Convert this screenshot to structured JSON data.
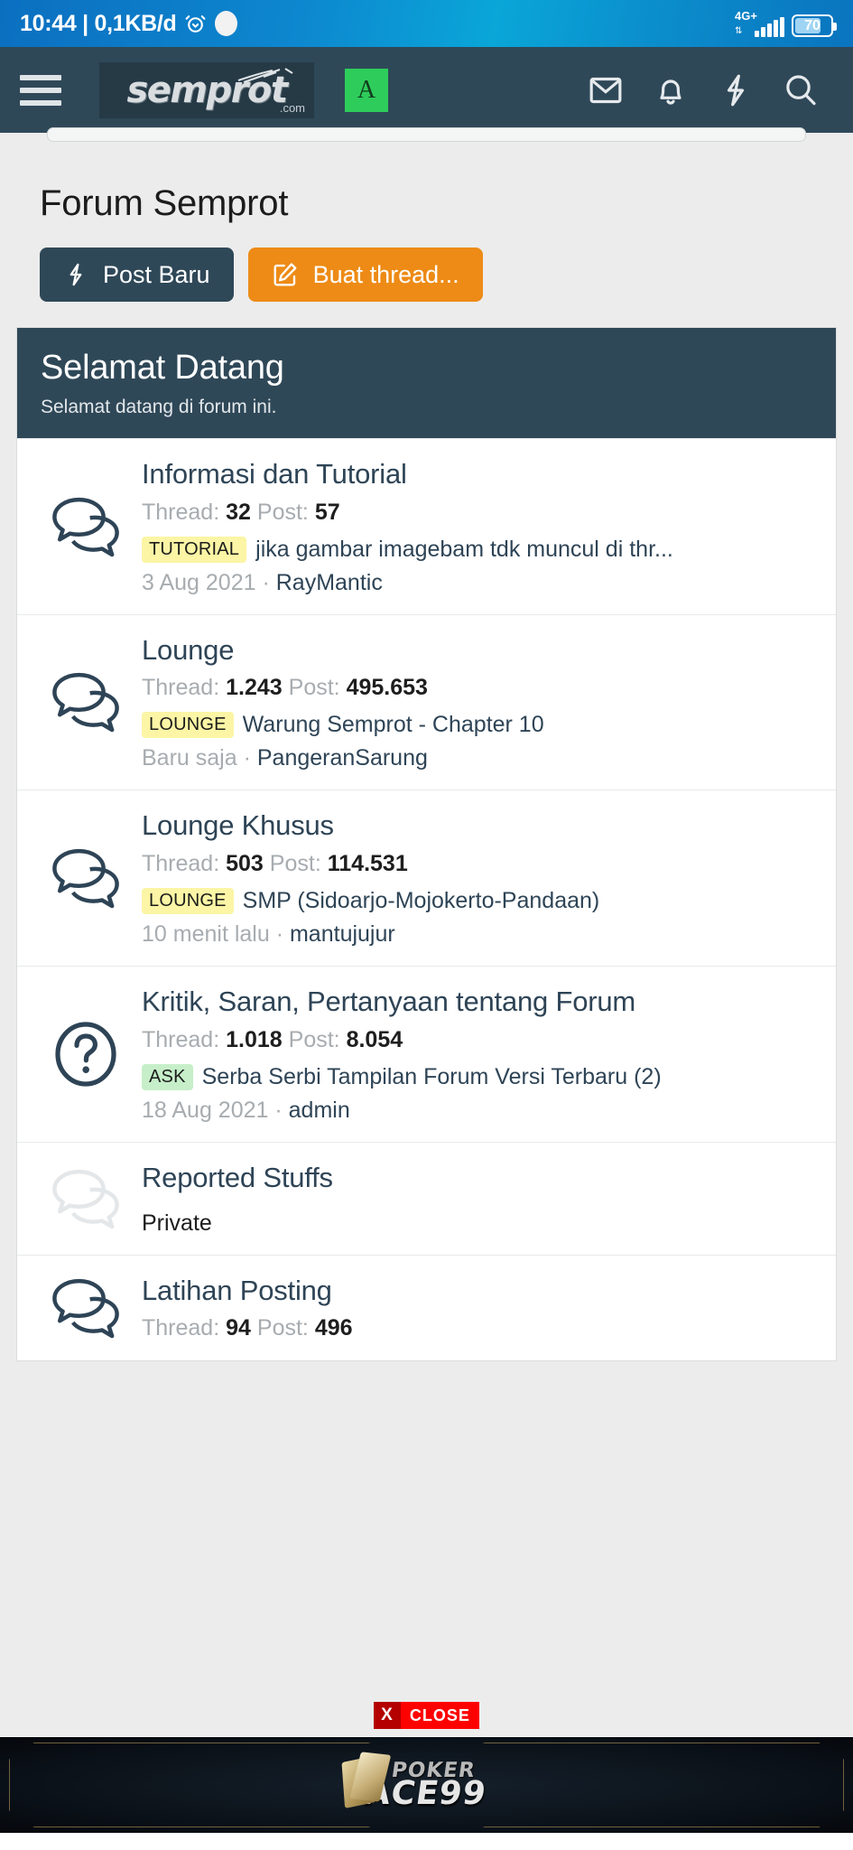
{
  "status_bar": {
    "time": "10:44",
    "separator": "|",
    "data_rate": "0,1KB/d",
    "alarm_icon": "alarm-clock-icon",
    "network_label": "4G+",
    "battery_level": "70"
  },
  "app_bar": {
    "menu_icon": "hamburger-menu-icon",
    "logo_text": "semprot",
    "logo_suffix": ".com",
    "avatar_letter": "A",
    "icons": [
      {
        "name": "inbox-icon",
        "label": "Inbox"
      },
      {
        "name": "bell-icon",
        "label": "Notifications"
      },
      {
        "name": "bolt-icon",
        "label": "What's new"
      },
      {
        "name": "search-icon",
        "label": "Search"
      }
    ]
  },
  "page": {
    "title": "Forum Semprot",
    "buttons": {
      "post_baru": "Post Baru",
      "buat_thread": "Buat thread..."
    }
  },
  "section": {
    "title": "Selamat Datang",
    "subtitle": "Selamat datang di forum ini."
  },
  "labels": {
    "thread": "Thread:",
    "post": "Post:",
    "dot": "·"
  },
  "forums": [
    {
      "name": "Informasi dan Tutorial",
      "icon": "speech-bubbles-icon",
      "threads": "32",
      "posts": "57",
      "prefix": "TUTORIAL",
      "prefix_color": "yellow",
      "last_title": "jika gambar imagebam tdk muncul di thr...",
      "date": "3 Aug 2021",
      "author": "RayMantic",
      "private": false
    },
    {
      "name": "Lounge",
      "icon": "speech-bubbles-icon",
      "threads": "1.243",
      "posts": "495.653",
      "prefix": "LOUNGE",
      "prefix_color": "yellow",
      "last_title": "Warung Semprot - Chapter 10",
      "date": "Baru saja",
      "author": "PangeranSarung",
      "private": false
    },
    {
      "name": "Lounge Khusus",
      "icon": "speech-bubbles-icon",
      "threads": "503",
      "posts": "114.531",
      "prefix": "LOUNGE",
      "prefix_color": "yellow",
      "last_title": "SMP (Sidoarjo-Mojokerto-Pandaan)",
      "date": "10 menit lalu",
      "author": "mantujujur",
      "private": false
    },
    {
      "name": "Kritik, Saran, Pertanyaan tentang Forum",
      "icon": "question-mark-circle-icon",
      "threads": "1.018",
      "posts": "8.054",
      "prefix": "ASK",
      "prefix_color": "green",
      "last_title": "Serba Serbi Tampilan Forum Versi Terbaru (2)",
      "date": "18 Aug 2021",
      "author": "admin",
      "private": false
    },
    {
      "name": "Reported Stuffs",
      "icon": "speech-bubbles-icon-dim",
      "threads": "",
      "posts": "",
      "prefix": "",
      "prefix_color": "",
      "last_title": "",
      "date": "",
      "author": "",
      "private": true,
      "private_label": "Private"
    },
    {
      "name": "Latihan Posting",
      "icon": "speech-bubbles-icon",
      "threads": "94",
      "posts": "496",
      "prefix": "",
      "prefix_color": "",
      "last_title": "",
      "date": "",
      "author": "",
      "private": false
    }
  ],
  "ad": {
    "close_x": "X",
    "close_label": "CLOSE",
    "brand_top": "POKER",
    "brand_bottom": "ACE99"
  },
  "colors": {
    "status_bar": "#0d87cf",
    "app_bar": "#2f4858",
    "accent_orange": "#ed8b16",
    "avatar_green": "#2ecc5b",
    "prefix_yellow": "#fbf5a5",
    "prefix_green": "#c6efc9",
    "link_dark": "#2e4456",
    "muted_text": "#a7acb0",
    "close_red": "#ff0000"
  }
}
